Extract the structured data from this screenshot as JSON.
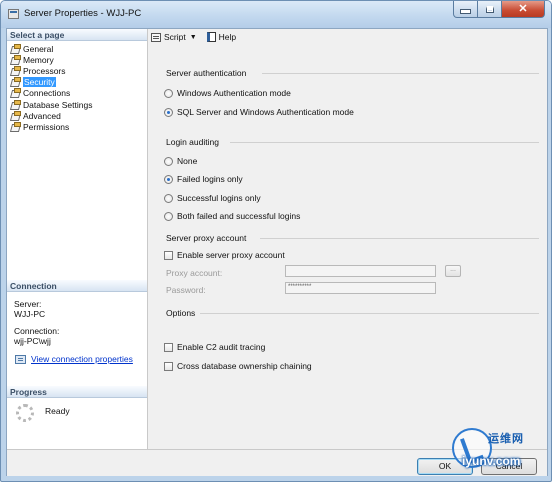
{
  "window": {
    "title": "Server Properties - WJJ-PC"
  },
  "left": {
    "select_page_header": "Select a page",
    "pages": [
      {
        "label": "General",
        "selected": false
      },
      {
        "label": "Memory",
        "selected": false
      },
      {
        "label": "Processors",
        "selected": false
      },
      {
        "label": "Security",
        "selected": true
      },
      {
        "label": "Connections",
        "selected": false
      },
      {
        "label": "Database Settings",
        "selected": false
      },
      {
        "label": "Advanced",
        "selected": false
      },
      {
        "label": "Permissions",
        "selected": false
      }
    ],
    "connection_header": "Connection",
    "server_label": "Server:",
    "server_value": "WJJ-PC",
    "connection_label": "Connection:",
    "connection_value": "wjj-PC\\wjj",
    "view_link": "View connection properties",
    "progress_header": "Progress",
    "progress_status": "Ready"
  },
  "toolbar": {
    "script_label": "Script",
    "help_label": "Help"
  },
  "security": {
    "server_auth": {
      "title": "Server authentication",
      "options": [
        "Windows Authentication mode",
        "SQL Server and Windows Authentication mode"
      ],
      "selected": "SQL Server and Windows Authentication mode"
    },
    "login_auditing": {
      "title": "Login auditing",
      "options": [
        "None",
        "Failed logins only",
        "Successful logins only",
        "Both failed and successful logins"
      ],
      "selected": "Failed logins only"
    },
    "proxy": {
      "title": "Server proxy account",
      "enable_label": "Enable server proxy account",
      "enabled": false,
      "proxy_account_label": "Proxy account:",
      "proxy_account_value": "",
      "password_label": "Password:",
      "password_value": "**********",
      "browse_label": "..."
    },
    "options": {
      "title": "Options",
      "c2_audit_label": "Enable C2 audit tracing",
      "c2_audit_checked": false,
      "cross_db_label": "Cross database ownership chaining",
      "cross_db_checked": false
    }
  },
  "buttons": {
    "ok": "OK",
    "cancel": "Cancel"
  },
  "watermark": {
    "cn": "运维网",
    "en": "iyunv.com"
  }
}
